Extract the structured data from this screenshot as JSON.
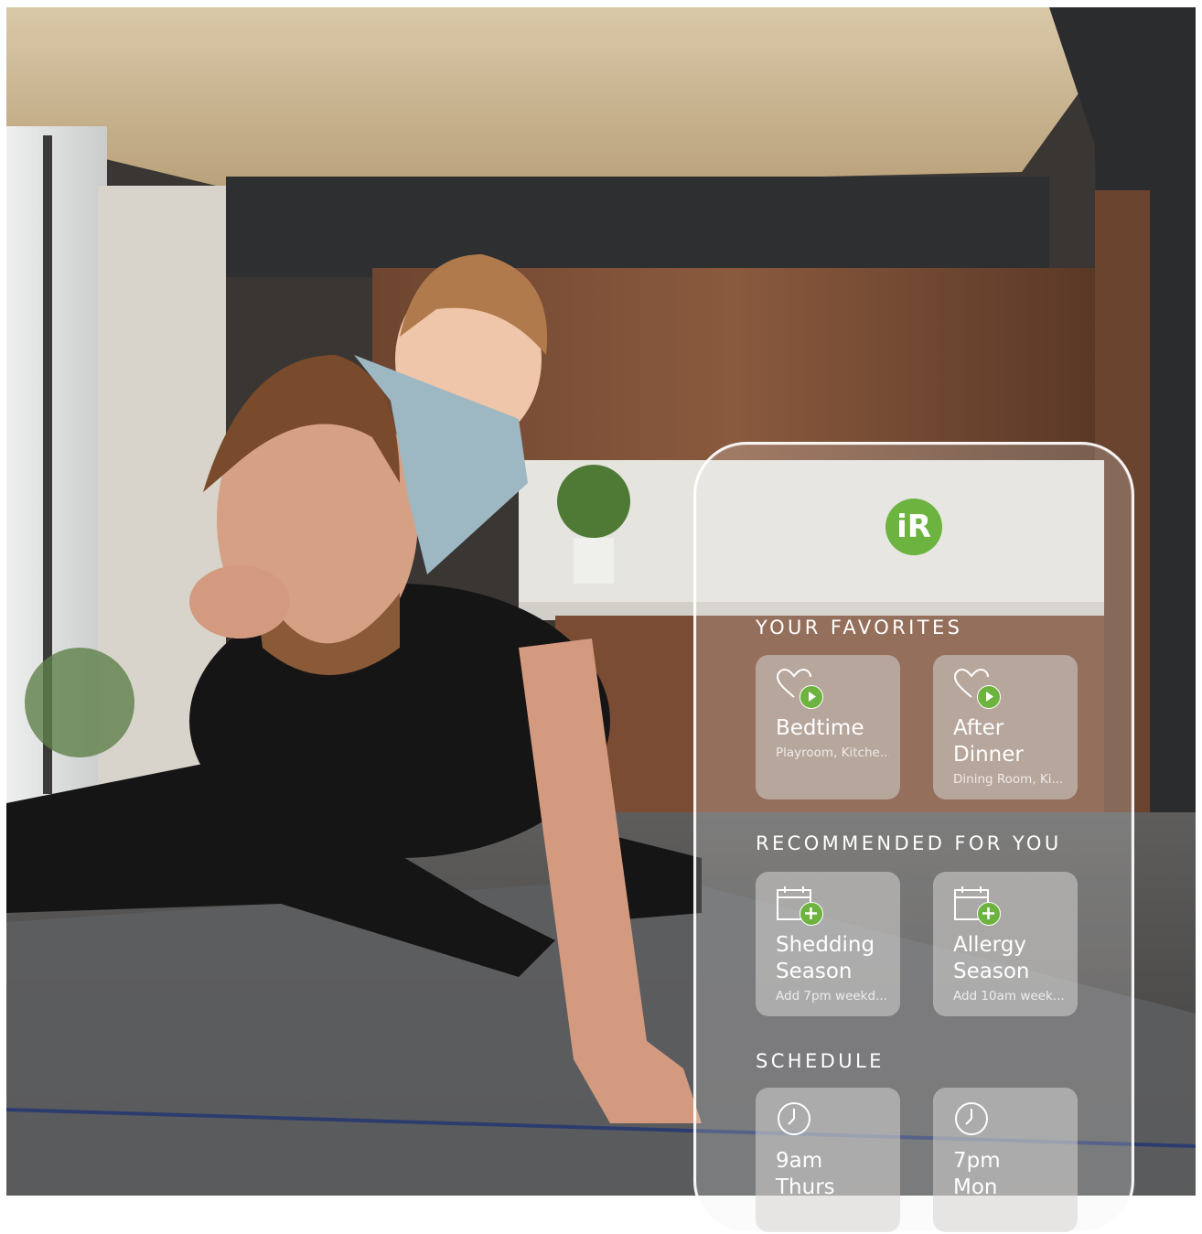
{
  "app": {
    "logo_text": "iR",
    "accent_color": "#6cb33f"
  },
  "favorites": {
    "title": "YOUR FAVORITES",
    "items": [
      {
        "name": "Bedtime",
        "sub": "Playroom, Kitche...",
        "icon": "heart-play-icon"
      },
      {
        "name": "After Dinner",
        "sub": "Dining Room, Ki...",
        "icon": "heart-play-icon"
      }
    ]
  },
  "recommended": {
    "title": "RECOMMENDED FOR YOU",
    "items": [
      {
        "name": "Shedding Season",
        "sub": "Add 7pm weekd...",
        "icon": "calendar-add-icon"
      },
      {
        "name": "Allergy Season",
        "sub": "Add 10am week...",
        "icon": "calendar-add-icon"
      }
    ]
  },
  "schedule": {
    "title": "SCHEDULE",
    "items": [
      {
        "name": "9am Thurs",
        "icon": "clock-icon"
      },
      {
        "name": "7pm Mon",
        "icon": "clock-icon"
      }
    ]
  }
}
